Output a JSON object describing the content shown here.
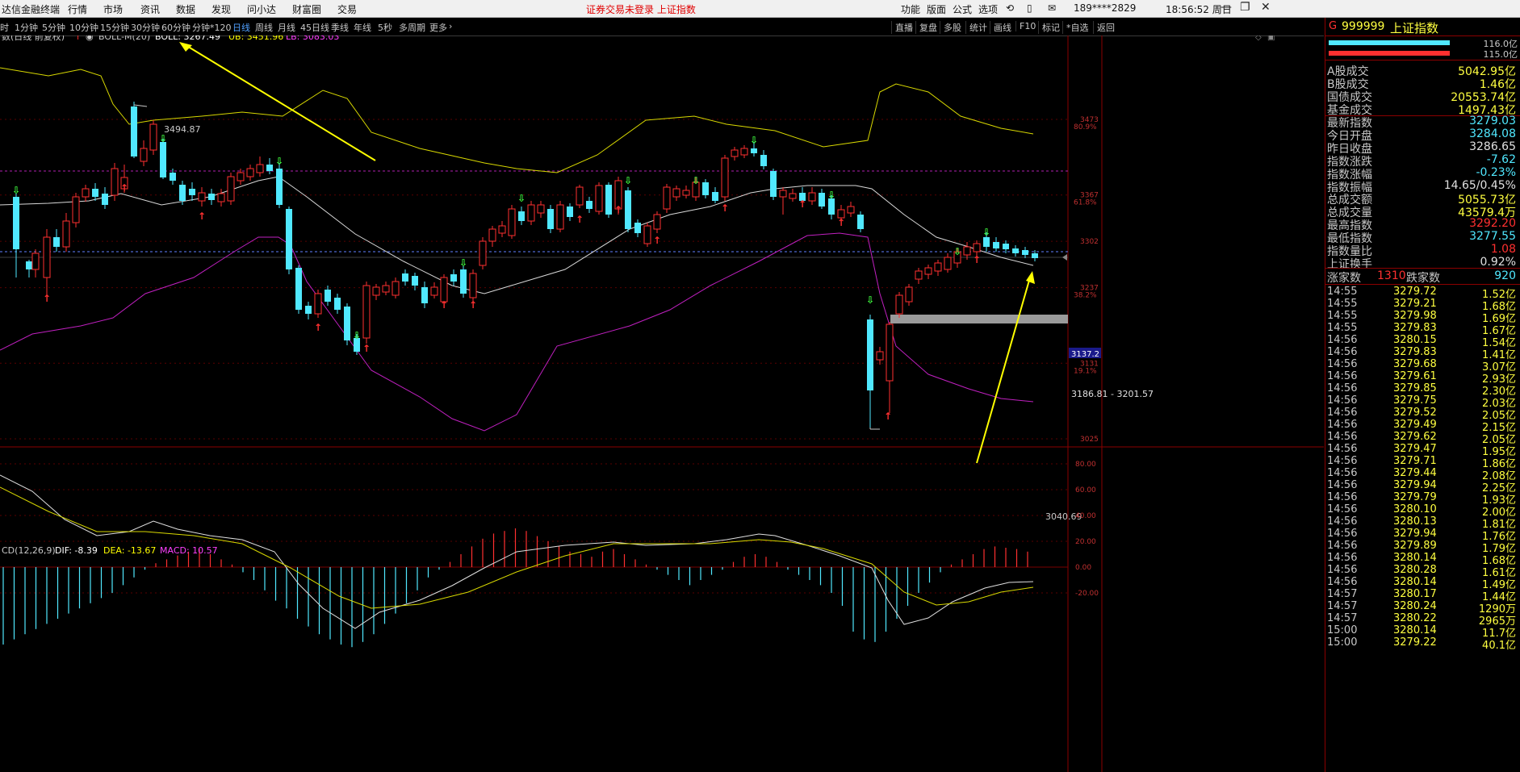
{
  "menubar": {
    "app_title": "达信金融终端",
    "items": [
      "行情",
      "市场",
      "资讯",
      "数据",
      "发现",
      "问小达",
      "财富圈",
      "交易"
    ],
    "notice": "证券交易未登录 上证指数",
    "right_items": [
      "功能",
      "版面",
      "公式",
      "选项"
    ],
    "account": "189****2829",
    "datetime": "18:56:52 周日"
  },
  "periods": {
    "items": [
      "时",
      "1分钟",
      "5分钟",
      "10分钟",
      "15分钟",
      "30分钟",
      "60分钟",
      "分钟*120",
      "日线",
      "周线",
      "月线",
      "45日线",
      "季线",
      "年线",
      "5秒",
      "多周期",
      "更多"
    ],
    "active": "日线"
  },
  "toolbar_right": [
    "直播",
    "复盘",
    "多股",
    "统计",
    "画线",
    "F10",
    "标记",
    "*自选",
    "返回"
  ],
  "main_chart": {
    "title": "数(日线 前复权)",
    "indicator": "BOLL-M(20)",
    "boll_label": "BOLL: 3267.49",
    "ub_label": "UB: 3451.96",
    "lb_label": "LB: 3083.03",
    "high_label": "3494.87",
    "low_label": "3040.69",
    "range_label": "3186.81 - 3201.57",
    "crosshair_price": "3137.2",
    "axis": [
      {
        "price": "3473",
        "pct": "80.9%"
      },
      {
        "price": "3367",
        "pct": "61.8%"
      },
      {
        "price": "3302",
        "pct": ""
      },
      {
        "price": "3237",
        "pct": "38.2%"
      },
      {
        "price": "3131",
        "pct": "19.1%"
      },
      {
        "price": "3025",
        "pct": ""
      }
    ]
  },
  "macd": {
    "title": "CD(12,26,9)",
    "dif": "DIF: -8.39",
    "dea": "DEA: -13.67",
    "macd": "MACD: 10.57",
    "axis": [
      "80.00",
      "60.00",
      "40.00",
      "20.00",
      "0.00",
      "-20.00"
    ]
  },
  "panel": {
    "code": "999999",
    "name": "上证指数",
    "flag": "G",
    "bar_values": [
      "116.0亿",
      "115.0亿"
    ],
    "vol_rows": [
      {
        "label": "A股成交",
        "value": "5042.95亿"
      },
      {
        "label": "B股成交",
        "value": "1.46亿"
      },
      {
        "label": "国债成交",
        "value": "20553.74亿"
      },
      {
        "label": "基金成交",
        "value": "1497.43亿"
      }
    ],
    "quote_rows": [
      {
        "label": "最新指数",
        "value": "3279.03",
        "color": "cyan"
      },
      {
        "label": "今日开盘",
        "value": "3284.08",
        "color": "cyan"
      },
      {
        "label": "昨日收盘",
        "value": "3286.65",
        "color": "white"
      },
      {
        "label": "指数涨跌",
        "value": "-7.62",
        "color": "cyan"
      },
      {
        "label": "指数涨幅",
        "value": "-0.23%",
        "color": "cyan"
      },
      {
        "label": "指数振幅",
        "value": "14.65/0.45%",
        "color": "white"
      },
      {
        "label": "总成交额",
        "value": "5055.73亿",
        "color": "yellow"
      },
      {
        "label": "总成交量",
        "value": "43579.4万",
        "color": "yellow"
      },
      {
        "label": "最高指数",
        "value": "3292.20",
        "color": "red"
      },
      {
        "label": "最低指数",
        "value": "3277.55",
        "color": "cyan"
      },
      {
        "label": "指数量比",
        "value": "1.08",
        "color": "red"
      },
      {
        "label": "上证换手",
        "value": "0.92%",
        "color": "white"
      }
    ],
    "rise_label": "涨家数",
    "rise_value": "1310",
    "fall_label": "跌家数",
    "fall_value": "920",
    "ticks": [
      [
        "14:55",
        "3279.72",
        "1.52亿"
      ],
      [
        "14:55",
        "3279.21",
        "1.68亿"
      ],
      [
        "14:55",
        "3279.98",
        "1.69亿"
      ],
      [
        "14:55",
        "3279.83",
        "1.67亿"
      ],
      [
        "14:56",
        "3280.15",
        "1.54亿"
      ],
      [
        "14:56",
        "3279.83",
        "1.41亿"
      ],
      [
        "14:56",
        "3279.68",
        "3.07亿"
      ],
      [
        "14:56",
        "3279.61",
        "2.93亿"
      ],
      [
        "14:56",
        "3279.85",
        "2.30亿"
      ],
      [
        "14:56",
        "3279.75",
        "2.03亿"
      ],
      [
        "14:56",
        "3279.52",
        "2.05亿"
      ],
      [
        "14:56",
        "3279.49",
        "2.15亿"
      ],
      [
        "14:56",
        "3279.62",
        "2.05亿"
      ],
      [
        "14:56",
        "3279.47",
        "1.95亿"
      ],
      [
        "14:56",
        "3279.71",
        "1.86亿"
      ],
      [
        "14:56",
        "3279.44",
        "2.08亿"
      ],
      [
        "14:56",
        "3279.94",
        "2.25亿"
      ],
      [
        "14:56",
        "3279.79",
        "1.93亿"
      ],
      [
        "14:56",
        "3280.10",
        "2.00亿"
      ],
      [
        "14:56",
        "3280.13",
        "1.81亿"
      ],
      [
        "14:56",
        "3279.94",
        "1.76亿"
      ],
      [
        "14:56",
        "3279.89",
        "1.79亿"
      ],
      [
        "14:56",
        "3280.14",
        "1.68亿"
      ],
      [
        "14:56",
        "3280.28",
        "1.61亿"
      ],
      [
        "14:56",
        "3280.14",
        "1.49亿"
      ],
      [
        "14:57",
        "3280.17",
        "1.44亿"
      ],
      [
        "14:57",
        "3280.24",
        "1290万"
      ],
      [
        "14:57",
        "3280.22",
        "2965万"
      ],
      [
        "15:00",
        "3280.14",
        "11.7亿"
      ],
      [
        "15:00",
        "3279.22",
        "40.1亿"
      ]
    ]
  },
  "colors": {
    "up": "#ff3030",
    "down": "#50e8ff",
    "boll_mid": "#d8d8d8",
    "boll_up": "#d8d800",
    "boll_low": "#c020c0",
    "axis_red": "#8b0000",
    "annotation": "#ffff00"
  }
}
